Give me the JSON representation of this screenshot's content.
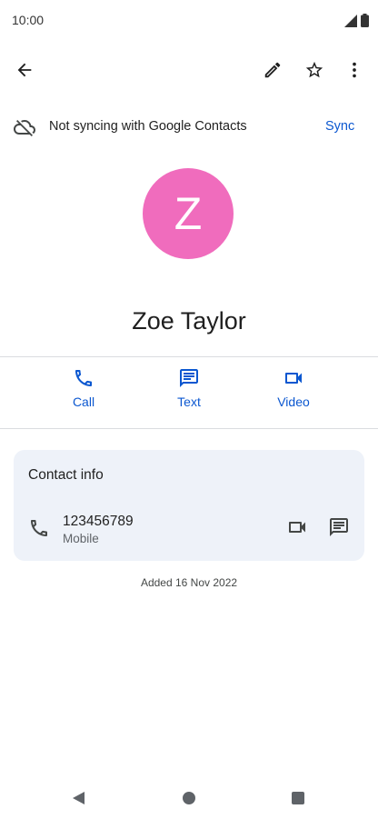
{
  "status_bar": {
    "time": "10:00"
  },
  "toolbar": {
    "back_icon": "arrow-back-icon",
    "edit_icon": "pencil-icon",
    "favorite_icon": "star-outline-icon",
    "more_icon": "more-vert-icon"
  },
  "sync_banner": {
    "text": "Not syncing with Google Contacts",
    "action": "Sync",
    "icon": "cloud-off-icon"
  },
  "contact": {
    "initial": "Z",
    "name": "Zoe Taylor",
    "avatar_color": "#f06cbd"
  },
  "actions": [
    {
      "label": "Call",
      "icon": "phone-icon"
    },
    {
      "label": "Text",
      "icon": "message-icon"
    },
    {
      "label": "Video",
      "icon": "videocam-icon"
    }
  ],
  "contact_info": {
    "title": "Contact info",
    "phone": {
      "number": "123456789",
      "type": "Mobile"
    }
  },
  "added": "Added 16 Nov 2022",
  "colors": {
    "accent": "#0b57d0",
    "card_bg": "#eef2f9"
  }
}
